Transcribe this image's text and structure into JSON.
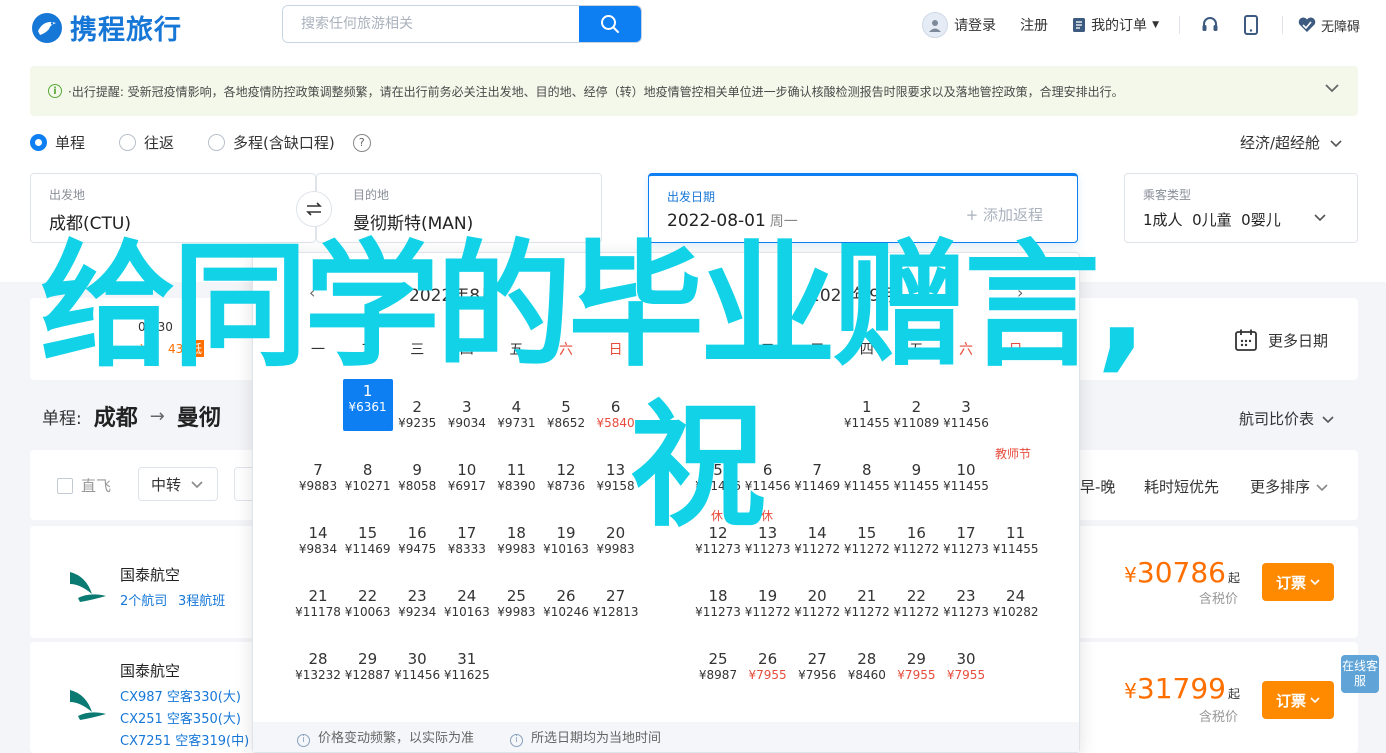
{
  "header": {
    "logo_text": "携程旅行",
    "search_placeholder": "搜索任何旅游相关",
    "login": "请登录",
    "register": "注册",
    "orders": "我的订单",
    "accessibility": "无障碍"
  },
  "notice": {
    "text": "·出行提醒: 受新冠疫情影响，各地疫情防控政策调整频繁，请在出行前务必关注出发地、目的地、经停（转）地疫情管控相关单位进一步确认核酸检测报告时限要求以及落地管控政策，合理安排出行。"
  },
  "trip_type": {
    "options": [
      "单程",
      "往返",
      "多程(含缺口程)"
    ],
    "selected": "单程"
  },
  "cabin_class": "经济/超经舱",
  "search_form": {
    "from_label": "出发地",
    "from_value": "成都(CTU)",
    "to_label": "目的地",
    "to_value": "曼彻斯特(MAN)",
    "date_label": "出发日期",
    "date_value": "2022-08-01",
    "date_weekday": "周一",
    "add_return": "+ 添加返程",
    "pax_label": "乘客类型",
    "pax_value": "1成人  0儿童  0婴儿"
  },
  "more_dates": "更多日期",
  "route": {
    "prefix": "单程:",
    "from": "成都",
    "arrow": "→",
    "to": "曼彻"
  },
  "fare_compare": "航司比价表",
  "filters": {
    "direct": "直飞",
    "transfer": "中转",
    "sort_early_late": "早-晚",
    "sort_shortest": "耗时短优先",
    "more_sort": "更多排序"
  },
  "strip_fragments": {
    "date": "07-30",
    "price_prefix": "¥6",
    "price_suffix": "43",
    "low": "低"
  },
  "flights": [
    {
      "airline": "国泰航空",
      "links": [
        "2个航司",
        "3程航班"
      ],
      "price": "30786",
      "price_suffix": "起",
      "tax": "含税价",
      "book": "订票"
    },
    {
      "airline": "国泰航空",
      "links": [
        "CX987 空客330(大)",
        "CX251 空客350(大)",
        "CX7251 空客319(中)"
      ],
      "price": "31799",
      "price_suffix": "起",
      "tax": "含税价",
      "book": "订票"
    }
  ],
  "online_service": "在线客服",
  "calendar": {
    "left_month": "2022年8月",
    "right_month": "2022年9月",
    "weekdays": [
      "一",
      "二",
      "三",
      "四",
      "五",
      "六",
      "日"
    ],
    "left_days": [
      {
        "d": "1",
        "p": "¥6361",
        "col": 1,
        "row": 0,
        "selected": true
      },
      {
        "d": "2",
        "p": "¥9235",
        "col": 2,
        "row": 0
      },
      {
        "d": "3",
        "p": "¥9034",
        "col": 3,
        "row": 0
      },
      {
        "d": "4",
        "p": "¥9731",
        "col": 4,
        "row": 0
      },
      {
        "d": "5",
        "p": "¥8652",
        "col": 5,
        "row": 0
      },
      {
        "d": "6",
        "p": "¥5840",
        "col": 6,
        "row": 0,
        "red": true
      },
      {
        "d": "7",
        "p": "¥9883",
        "col": 0,
        "row": 1
      },
      {
        "d": "8",
        "p": "¥10271",
        "col": 1,
        "row": 1
      },
      {
        "d": "9",
        "p": "¥8058",
        "col": 2,
        "row": 1
      },
      {
        "d": "10",
        "p": "¥6917",
        "col": 3,
        "row": 1
      },
      {
        "d": "11",
        "p": "¥8390",
        "col": 4,
        "row": 1
      },
      {
        "d": "12",
        "p": "¥8736",
        "col": 5,
        "row": 1
      },
      {
        "d": "13",
        "p": "¥9158",
        "col": 6,
        "row": 1
      },
      {
        "d": "14",
        "p": "¥9834",
        "col": 0,
        "row": 2
      },
      {
        "d": "15",
        "p": "¥11469",
        "col": 1,
        "row": 2
      },
      {
        "d": "16",
        "p": "¥9475",
        "col": 2,
        "row": 2
      },
      {
        "d": "17",
        "p": "¥8333",
        "col": 3,
        "row": 2
      },
      {
        "d": "18",
        "p": "¥9983",
        "col": 4,
        "row": 2
      },
      {
        "d": "19",
        "p": "¥10163",
        "col": 5,
        "row": 2
      },
      {
        "d": "20",
        "p": "¥9983",
        "col": 6,
        "row": 2
      },
      {
        "d": "21",
        "p": "¥11178",
        "col": 0,
        "row": 3
      },
      {
        "d": "22",
        "p": "¥10063",
        "col": 1,
        "row": 3
      },
      {
        "d": "23",
        "p": "¥9234",
        "col": 2,
        "row": 3
      },
      {
        "d": "24",
        "p": "¥10163",
        "col": 3,
        "row": 3
      },
      {
        "d": "25",
        "p": "¥9983",
        "col": 4,
        "row": 3
      },
      {
        "d": "26",
        "p": "¥10246",
        "col": 5,
        "row": 3
      },
      {
        "d": "27",
        "p": "¥12813",
        "col": 6,
        "row": 3
      },
      {
        "d": "28",
        "p": "¥13232",
        "col": 0,
        "row": 4
      },
      {
        "d": "29",
        "p": "¥12887",
        "col": 1,
        "row": 4
      },
      {
        "d": "30",
        "p": "¥11456",
        "col": 2,
        "row": 4
      },
      {
        "d": "31",
        "p": "¥11625",
        "col": 3,
        "row": 4
      }
    ],
    "right_days": [
      {
        "d": "1",
        "p": "¥11455",
        "col": 3,
        "row": 0
      },
      {
        "d": "2",
        "p": "¥11089",
        "col": 4,
        "row": 0
      },
      {
        "d": "3",
        "p": "¥11456",
        "col": 5,
        "row": 0
      },
      {
        "d": "5",
        "p": "¥11456",
        "col": 0,
        "row": 1
      },
      {
        "d": "6",
        "p": "¥11456",
        "col": 1,
        "row": 1
      },
      {
        "d": "7",
        "p": "¥11469",
        "col": 2,
        "row": 1
      },
      {
        "d": "8",
        "p": "¥11455",
        "col": 3,
        "row": 1
      },
      {
        "d": "9",
        "p": "¥11455",
        "col": 4,
        "row": 1
      },
      {
        "d": "10",
        "p": "¥11455",
        "col": 5,
        "row": 1
      },
      {
        "d": "11",
        "p": "¥11455",
        "col": 6,
        "row": 2
      },
      {
        "d": "12",
        "p": "¥11273",
        "col": 0,
        "row": 2
      },
      {
        "d": "13",
        "p": "¥11273",
        "col": 1,
        "row": 2
      },
      {
        "d": "14",
        "p": "¥11272",
        "col": 2,
        "row": 2
      },
      {
        "d": "15",
        "p": "¥11272",
        "col": 3,
        "row": 2
      },
      {
        "d": "16",
        "p": "¥11272",
        "col": 4,
        "row": 2
      },
      {
        "d": "17",
        "p": "¥11273",
        "col": 5,
        "row": 2
      },
      {
        "d": "18",
        "p": "¥11273",
        "col": 0,
        "row": 3
      },
      {
        "d": "19",
        "p": "¥11272",
        "col": 1,
        "row": 3
      },
      {
        "d": "20",
        "p": "¥11272",
        "col": 2,
        "row": 3
      },
      {
        "d": "21",
        "p": "¥11272",
        "col": 3,
        "row": 3
      },
      {
        "d": "22",
        "p": "¥11272",
        "col": 4,
        "row": 3
      },
      {
        "d": "23",
        "p": "¥11273",
        "col": 5,
        "row": 3
      },
      {
        "d": "24",
        "p": "¥10282",
        "col": 6,
        "row": 3
      },
      {
        "d": "25",
        "p": "¥8987",
        "col": 0,
        "row": 4
      },
      {
        "d": "26",
        "p": "¥7955",
        "col": 1,
        "row": 4,
        "red": true
      },
      {
        "d": "27",
        "p": "¥7956",
        "col": 2,
        "row": 4
      },
      {
        "d": "28",
        "p": "¥8460",
        "col": 3,
        "row": 4
      },
      {
        "d": "29",
        "p": "¥7955",
        "col": 4,
        "row": 4,
        "red": true
      },
      {
        "d": "30",
        "p": "¥7955",
        "col": 5,
        "row": 4,
        "red": true
      }
    ],
    "holiday_labels": [
      "教师节",
      "休",
      "休"
    ],
    "footer": [
      "价格变动频繁，以实际为准",
      "所选日期均为当地时间"
    ]
  },
  "overlay": {
    "line1": "给同学的毕业赠言,",
    "line2": "祝"
  },
  "colors": {
    "brand_blue": "#0e7ff3",
    "price_orange": "#ff6f00",
    "book_orange": "#ff8a00",
    "overlay_cyan": "#12d2e8"
  }
}
